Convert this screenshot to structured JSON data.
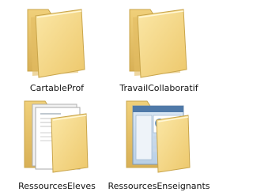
{
  "folders": [
    {
      "label": "CartableProf",
      "icon": "empty-folder-icon"
    },
    {
      "label": "TravailCollaboratif",
      "icon": "empty-folder-icon"
    },
    {
      "label": "RessourcesEleves",
      "icon": "folder-with-document-icon"
    },
    {
      "label": "RessourcesEnseignants",
      "icon": "folder-with-screenshot-icon"
    }
  ],
  "colors": {
    "folder_back": "#e7c36b",
    "folder_front": "#f6dc8c",
    "folder_shadow": "#c9a54b",
    "text": "#111111",
    "background": "#ffffff"
  }
}
